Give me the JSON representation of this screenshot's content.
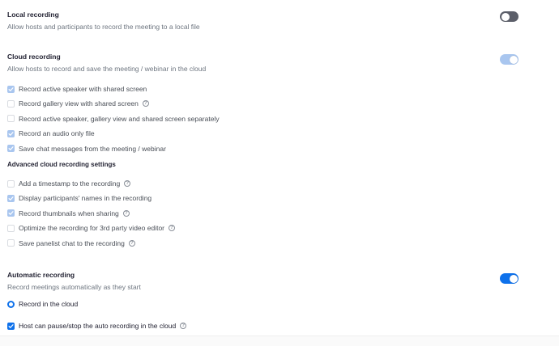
{
  "local_recording": {
    "title": "Local recording",
    "description": "Allow hosts and participants to record the meeting to a local file",
    "enabled": false
  },
  "cloud_recording": {
    "title": "Cloud recording",
    "description": "Allow hosts to record and save the meeting / webinar in the cloud",
    "enabled": true,
    "options": [
      {
        "label": "Record active speaker with shared screen",
        "checked": true,
        "help": false
      },
      {
        "label": "Record gallery view with shared screen",
        "checked": false,
        "help": true
      },
      {
        "label": "Record active speaker, gallery view and shared screen separately",
        "checked": false,
        "help": false
      },
      {
        "label": "Record an audio only file",
        "checked": true,
        "help": false
      },
      {
        "label": "Save chat messages from the meeting / webinar",
        "checked": true,
        "help": false
      }
    ],
    "advanced_title": "Advanced cloud recording settings",
    "advanced_options": [
      {
        "label": "Add a timestamp to the recording",
        "checked": false,
        "help": true
      },
      {
        "label": "Display participants' names in the recording",
        "checked": true,
        "help": false
      },
      {
        "label": "Record thumbnails when sharing",
        "checked": true,
        "help": true
      },
      {
        "label": "Optimize the recording for 3rd party video editor",
        "checked": false,
        "help": true
      },
      {
        "label": "Save panelist chat to the recording",
        "checked": false,
        "help": true
      }
    ]
  },
  "automatic_recording": {
    "title": "Automatic recording",
    "description": "Record meetings automatically as they start",
    "enabled": true,
    "radio_label": "Record in the cloud",
    "host_pause_label": "Host can pause/stop the auto recording in the cloud",
    "host_pause_checked": true
  },
  "help_glyph": "?",
  "colors": {
    "accent": "#0e71eb",
    "accent_disabled": "#a9c6ef",
    "toggle_off": "#5c5f6a"
  }
}
